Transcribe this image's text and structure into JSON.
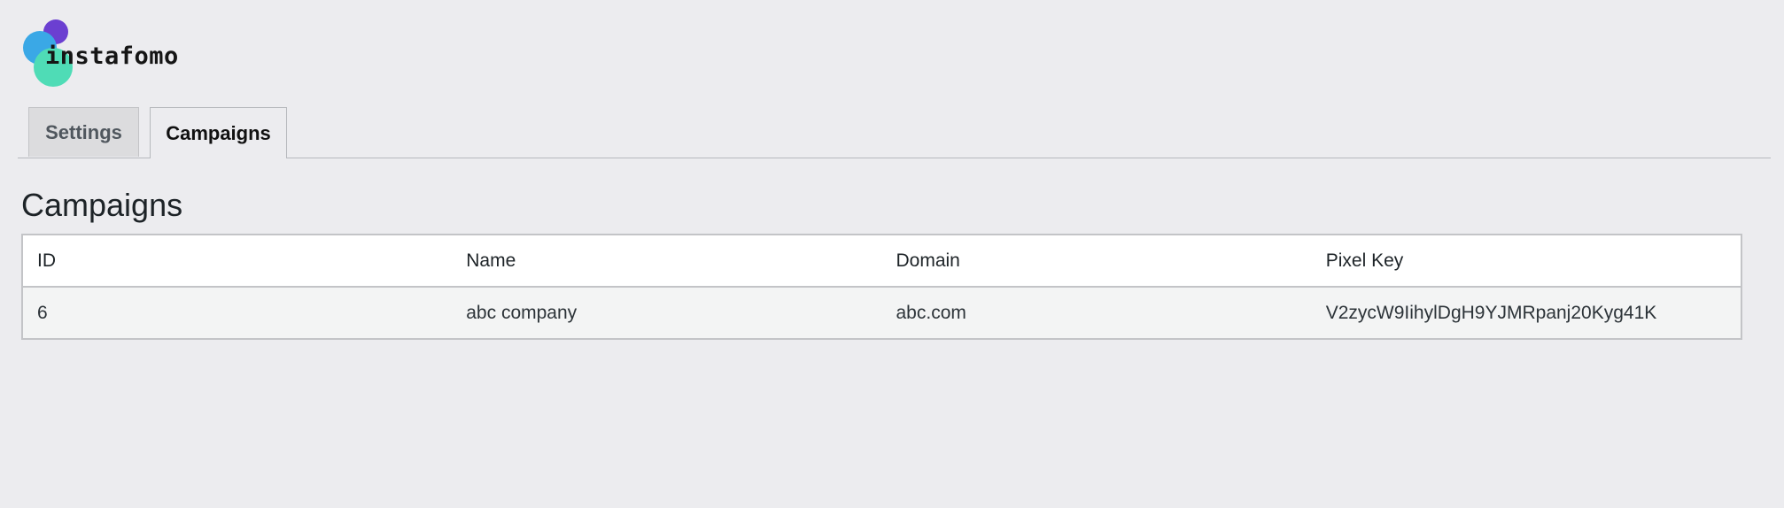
{
  "brand": {
    "name": "instafomo",
    "colors": {
      "purple": "#6b3fd1",
      "blue": "#3aa8e6",
      "green": "#4fdcb6"
    }
  },
  "tabs": [
    {
      "label": "Settings",
      "active": false
    },
    {
      "label": "Campaigns",
      "active": true
    }
  ],
  "page": {
    "title": "Campaigns"
  },
  "table": {
    "columns": [
      "ID",
      "Name",
      "Domain",
      "Pixel Key"
    ],
    "rows": [
      {
        "id": "6",
        "name": "abc company",
        "domain": "abc.com",
        "pixel_key": "V2zycW9IihylDgH9YJMRpanj20Kyg41K"
      }
    ]
  }
}
